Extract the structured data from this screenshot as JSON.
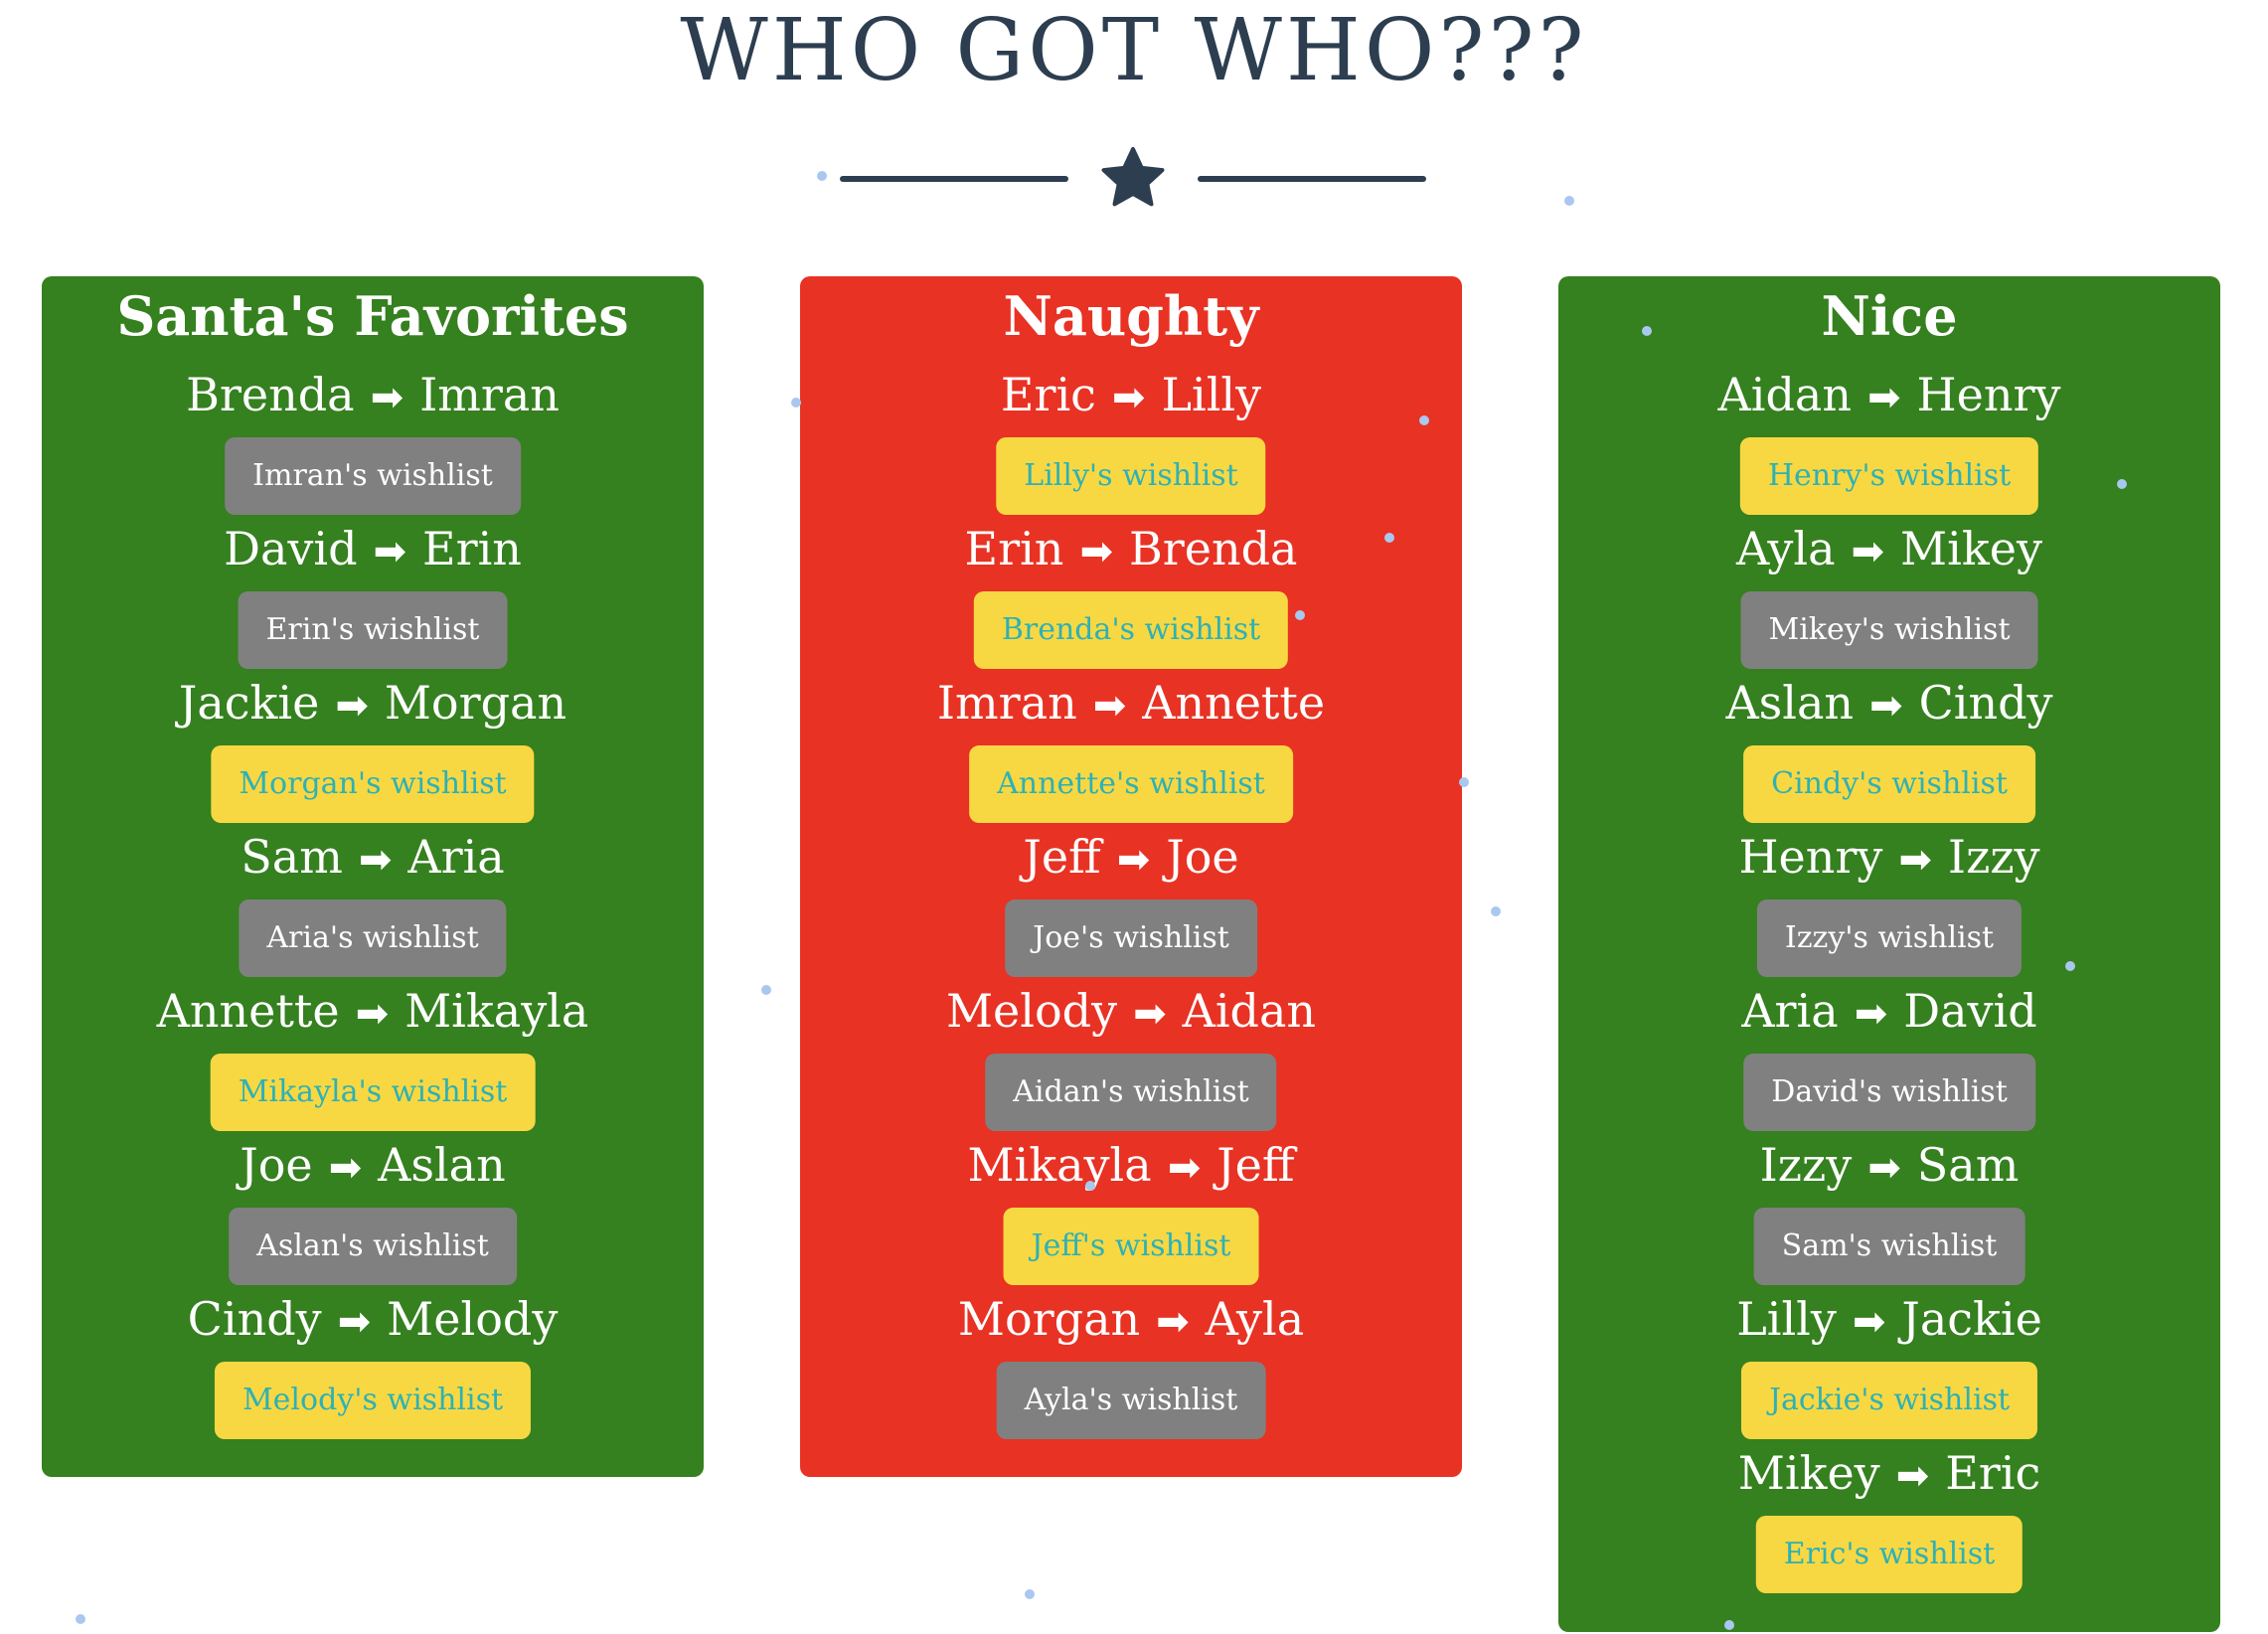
{
  "page": {
    "title": "WHO GOT WHO???"
  },
  "icons": {
    "divider": "star-icon",
    "arrow": "right-arrow-icon"
  },
  "colors": {
    "title": "#2c3e50",
    "green_panel": "#35801f",
    "red_panel": "#e83224",
    "gray_button": "#808080",
    "yellow_button": "#f7d842",
    "yellow_button_text": "#2eb1b5",
    "snow": "#a9c8ef"
  },
  "columns": [
    {
      "title": "Santa's Favorites",
      "color": "#35801f",
      "entries": [
        {
          "giver": "Brenda",
          "arrow": "➡",
          "receiver": "Imran",
          "wishlist": "Imran's wishlist",
          "style": "gray"
        },
        {
          "giver": "David",
          "arrow": "➡",
          "receiver": "Erin",
          "wishlist": "Erin's wishlist",
          "style": "gray"
        },
        {
          "giver": "Jackie",
          "arrow": "➡",
          "receiver": "Morgan",
          "wishlist": "Morgan's wishlist",
          "style": "yellow"
        },
        {
          "giver": "Sam",
          "arrow": "➡",
          "receiver": "Aria",
          "wishlist": "Aria's wishlist",
          "style": "gray"
        },
        {
          "giver": "Annette",
          "arrow": "➡",
          "receiver": "Mikayla",
          "wishlist": "Mikayla's wishlist",
          "style": "yellow"
        },
        {
          "giver": "Joe",
          "arrow": "➡",
          "receiver": "Aslan",
          "wishlist": "Aslan's wishlist",
          "style": "gray"
        },
        {
          "giver": "Cindy",
          "arrow": "➡",
          "receiver": "Melody",
          "wishlist": "Melody's wishlist",
          "style": "yellow"
        }
      ]
    },
    {
      "title": "Naughty",
      "color": "#e83224",
      "entries": [
        {
          "giver": "Eric",
          "arrow": "➡",
          "receiver": "Lilly",
          "wishlist": "Lilly's wishlist",
          "style": "yellow"
        },
        {
          "giver": "Erin",
          "arrow": "➡",
          "receiver": "Brenda",
          "wishlist": "Brenda's wishlist",
          "style": "yellow"
        },
        {
          "giver": "Imran",
          "arrow": "➡",
          "receiver": "Annette",
          "wishlist": "Annette's wishlist",
          "style": "yellow"
        },
        {
          "giver": "Jeff",
          "arrow": "➡",
          "receiver": "Joe",
          "wishlist": "Joe's wishlist",
          "style": "gray"
        },
        {
          "giver": "Melody",
          "arrow": "➡",
          "receiver": "Aidan",
          "wishlist": "Aidan's wishlist",
          "style": "gray"
        },
        {
          "giver": "Mikayla",
          "arrow": "➡",
          "receiver": "Jeff",
          "wishlist": "Jeff's wishlist",
          "style": "yellow"
        },
        {
          "giver": "Morgan",
          "arrow": "➡",
          "receiver": "Ayla",
          "wishlist": "Ayla's wishlist",
          "style": "gray"
        }
      ]
    },
    {
      "title": "Nice",
      "color": "#35801f",
      "entries": [
        {
          "giver": "Aidan",
          "arrow": "➡",
          "receiver": "Henry",
          "wishlist": "Henry's wishlist",
          "style": "yellow"
        },
        {
          "giver": "Ayla",
          "arrow": "➡",
          "receiver": "Mikey",
          "wishlist": "Mikey's wishlist",
          "style": "gray"
        },
        {
          "giver": "Aslan",
          "arrow": "➡",
          "receiver": "Cindy",
          "wishlist": "Cindy's wishlist",
          "style": "yellow"
        },
        {
          "giver": "Henry",
          "arrow": "➡",
          "receiver": "Izzy",
          "wishlist": "Izzy's wishlist",
          "style": "gray"
        },
        {
          "giver": "Aria",
          "arrow": "➡",
          "receiver": "David",
          "wishlist": "David's wishlist",
          "style": "gray"
        },
        {
          "giver": "Izzy",
          "arrow": "➡",
          "receiver": "Sam",
          "wishlist": "Sam's wishlist",
          "style": "gray"
        },
        {
          "giver": "Lilly",
          "arrow": "➡",
          "receiver": "Jackie",
          "wishlist": "Jackie's wishlist",
          "style": "yellow"
        },
        {
          "giver": "Mikey",
          "arrow": "➡",
          "receiver": "Eric",
          "wishlist": "Eric's wishlist",
          "style": "yellow"
        }
      ]
    }
  ]
}
